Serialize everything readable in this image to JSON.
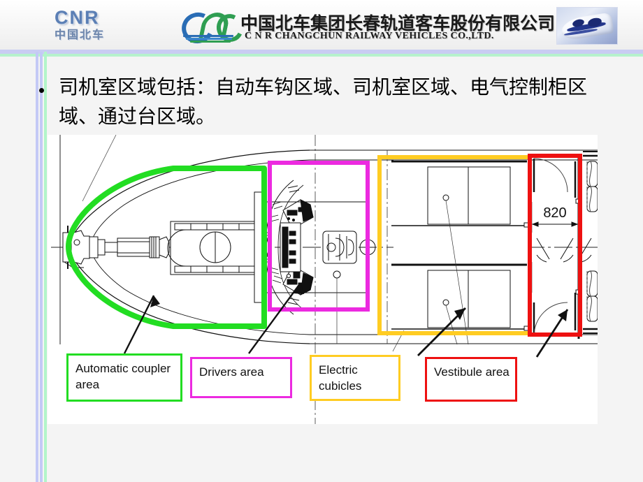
{
  "header": {
    "cnr_logo": {
      "english": "CNR",
      "chinese": "中国北车",
      "icon": "cnr-logo-icon"
    },
    "crc_mark_icon": "crc-emblem-icon",
    "company_name_cn": "中国北车集团长春轨道客车股份有限公司",
    "company_name_en": "C N R   CHANGCHUN RAILWAY VEHICLES CO.,LTD.",
    "train_photo_icon": "high-speed-train-photo"
  },
  "body": {
    "bullet_text": "司机室区域包括：自动车钩区域、司机室区域、电气控制柜区域、通过台区域。"
  },
  "drawing": {
    "dimension_label": "820",
    "legend": [
      {
        "label": "Automatic coupler area",
        "color": "#22dd22",
        "name": "automatic-coupler-area"
      },
      {
        "label": "Drivers area",
        "color": "#ec2ae0",
        "name": "drivers-area"
      },
      {
        "label": "Electric cubicles",
        "color": "#ffcc22",
        "name": "electric-cubicles"
      },
      {
        "label": "Vestibule area",
        "color": "#ee1111",
        "name": "vestibule-area"
      }
    ]
  },
  "colors": {
    "green": "#22dd22",
    "magenta": "#ec2ae0",
    "gold": "#ffcc22",
    "red": "#ee1111",
    "slide_bg": "#f4f4f4",
    "panel_bg": "#ffffff",
    "guide_blue": "#c3c9f6",
    "guide_green": "#b2f5c9"
  }
}
